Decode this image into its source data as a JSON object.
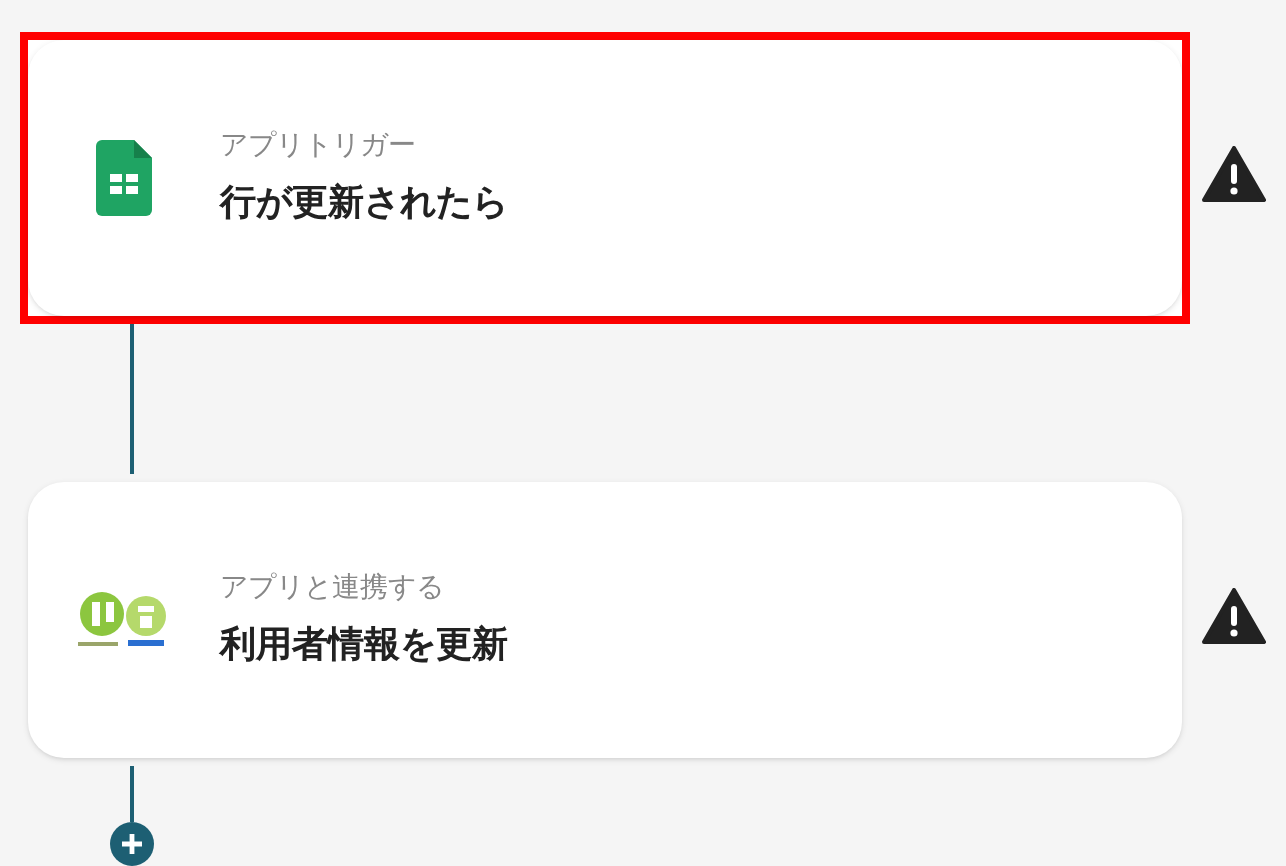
{
  "steps": [
    {
      "kind": "sheets",
      "label": "アプリトリガー",
      "title": "行が更新されたら",
      "highlighted": true,
      "warning": true
    },
    {
      "kind": "partner",
      "label": "アプリと連携する",
      "title": "利用者情報を更新",
      "highlighted": false,
      "warning": true
    }
  ]
}
